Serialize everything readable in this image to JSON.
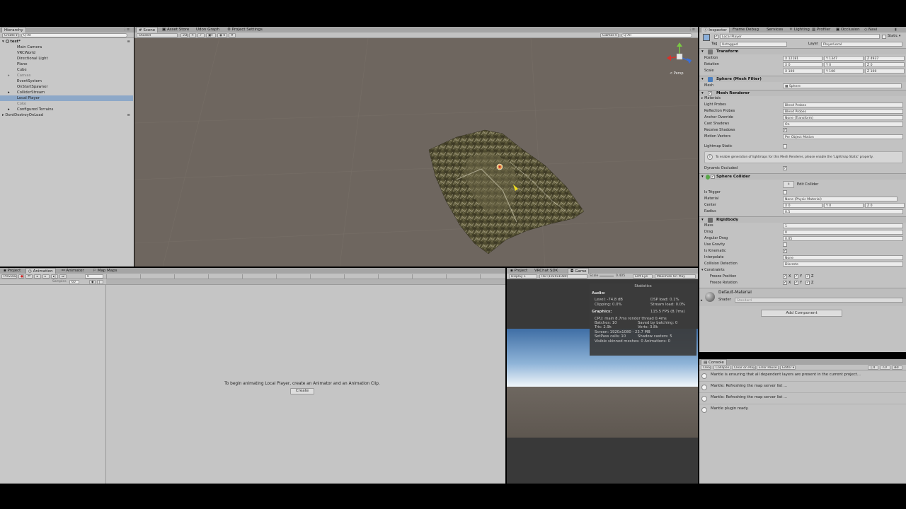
{
  "hierarchy": {
    "tab": "Hierarchy",
    "create": "Create ▾",
    "search_placeholder": "Q-All",
    "scene": "test*",
    "items": [
      {
        "label": "Main Camera"
      },
      {
        "label": "VRCWorld"
      },
      {
        "label": "Directional Light"
      },
      {
        "label": "Plane"
      },
      {
        "label": "Cube"
      },
      {
        "label": "Canvas"
      },
      {
        "label": "EventSystem"
      },
      {
        "label": "OnStartSpawner"
      },
      {
        "label": "ColliderStream"
      },
      {
        "label": "Local Player"
      },
      {
        "label": "Coke"
      },
      {
        "label": "Configured Terrains"
      }
    ],
    "dontdestroy": "DontDestroyOnLoad"
  },
  "scene_tabs": [
    "Scene",
    "Asset Store",
    "Udon Graph",
    "Project Settings"
  ],
  "scene_toolbar": {
    "shaded": "Shaded",
    "mode2d": "2D",
    "gizmos": "Gizmos ▾",
    "search": "Q-All"
  },
  "gizmo_label": "< Persp",
  "bottom_tabs": [
    "Project",
    "Animation",
    "Animator",
    "Map Maps"
  ],
  "animation": {
    "preview": "Preview",
    "samples_label": "Samples",
    "samples": "60",
    "message": "To begin animating Local Player, create an Animator and an Animation Clip.",
    "create": "Create"
  },
  "game_tabs": [
    "Project",
    "VRChat SDK",
    "Game"
  ],
  "game_toolbar": {
    "display": "Display 1",
    "resolution": "HD (1920x1080)",
    "scale_label": "Scale",
    "scale": "0.405",
    "left_eye": "Left Eye",
    "maximize": "Maximize On Play"
  },
  "statistics": {
    "title": "Statistics",
    "audio_header": "Audio:",
    "level": "Level: -74.8 dB",
    "clipping": "Clipping: 0.0%",
    "dsp": "DSP load: 0.1%",
    "stream": "Stream load: 0.0%",
    "graphics_header": "Graphics:",
    "fps": "115.5 FPS (8.7ms)",
    "cpu": "CPU: main 8.7ms  render thread 0.4ms",
    "batches": "Batches: 10",
    "saved": "Saved by batching: 0",
    "tris": "Tris: 2.9k",
    "verts": "Verts: 3.8k",
    "screen": "Screen: 1920x1080 - 23.7 MB",
    "setpass": "SetPass calls: 10",
    "shadow": "Shadow casters: 5",
    "skinned": "Visible skinned meshes: 0  Animations: 0"
  },
  "inspector_tabs": [
    "Inspector",
    "Frame Debug",
    "Services",
    "Lighting",
    "Profiler",
    "Occlusion",
    "Navi"
  ],
  "inspector": {
    "name": "Local Player",
    "static": "Static ▾",
    "tag_label": "Tag",
    "tag": "Untagged",
    "layer_label": "Layer",
    "layer": "PlayerLocal",
    "transform": {
      "title": "Transform",
      "position_label": "Position",
      "rotation_label": "Rotation",
      "scale_label": "Scale",
      "position": [
        "12181",
        "1347",
        "4937"
      ],
      "rotation": [
        "0",
        "0",
        "0"
      ],
      "scale": [
        "100",
        "100",
        "100"
      ]
    },
    "mesh_filter": {
      "title": "Sphere (Mesh Filter)",
      "mesh_label": "Mesh",
      "mesh": "Sphere"
    },
    "mesh_renderer": {
      "title": "Mesh Renderer",
      "materials": "Materials",
      "light_probes_label": "Light Probes",
      "light_probes": "Blend Probes",
      "reflection_label": "Reflection Probes",
      "reflection": "Blend Probes",
      "anchor_label": "Anchor Override",
      "anchor": "None (Transform)",
      "cast_label": "Cast Shadows",
      "cast": "On",
      "receive_label": "Receive Shadows",
      "motion_label": "Motion Vectors",
      "motion": "Per Object Motion",
      "lightmap_label": "Lightmap Static",
      "info": "To enable generation of lightmaps for this Mesh Renderer, please enable the 'Lightmap Static' property.",
      "dynamic_label": "Dynamic Occluded"
    },
    "sphere_collider": {
      "title": "Sphere Collider",
      "edit": "Edit Collider",
      "trigger_label": "Is Trigger",
      "material_label": "Material",
      "material": "None (Physic Material)",
      "center_label": "Center",
      "center": [
        "0",
        "0",
        "0"
      ],
      "radius_label": "Radius",
      "radius": "0.5"
    },
    "rigidbody": {
      "title": "Rigidbody",
      "mass_label": "Mass",
      "mass": "1",
      "drag_label": "Drag",
      "drag": "0",
      "angular_label": "Angular Drag",
      "angular": "0.05",
      "gravity_label": "Use Gravity",
      "kinematic_label": "Is Kinematic",
      "interpolate_label": "Interpolate",
      "interpolate": "None",
      "collision_label": "Collision Detection",
      "collision": "Discrete",
      "constraints": "Constraints",
      "freeze_pos": "Freeze Position",
      "freeze_rot": "Freeze Rotation"
    },
    "material": {
      "name": "Default-Material",
      "shader_label": "Shader",
      "shader": "Standard"
    },
    "add_component": "Add Component"
  },
  "console": {
    "tab": "Console",
    "buttons": [
      "Clear",
      "Collapse",
      "Clear on Play",
      "Error Pause",
      "Editor ▾"
    ],
    "counts": [
      "4",
      "0",
      "0"
    ],
    "messages": [
      {
        "text": "Mantle is ensuring that all dependent layers are present in the current project..."
      },
      {
        "text": "Mantle: Refreshing the map server list ..."
      },
      {
        "text": "Mantle: Refreshing the map server list ..."
      },
      {
        "text": "Mantle plugin ready."
      }
    ]
  },
  "colors": {
    "panel": "#c8c8c8",
    "scene_bg": "#6e665f",
    "selected": "#8da8c8",
    "stats_bg": "#3d3d3d"
  }
}
